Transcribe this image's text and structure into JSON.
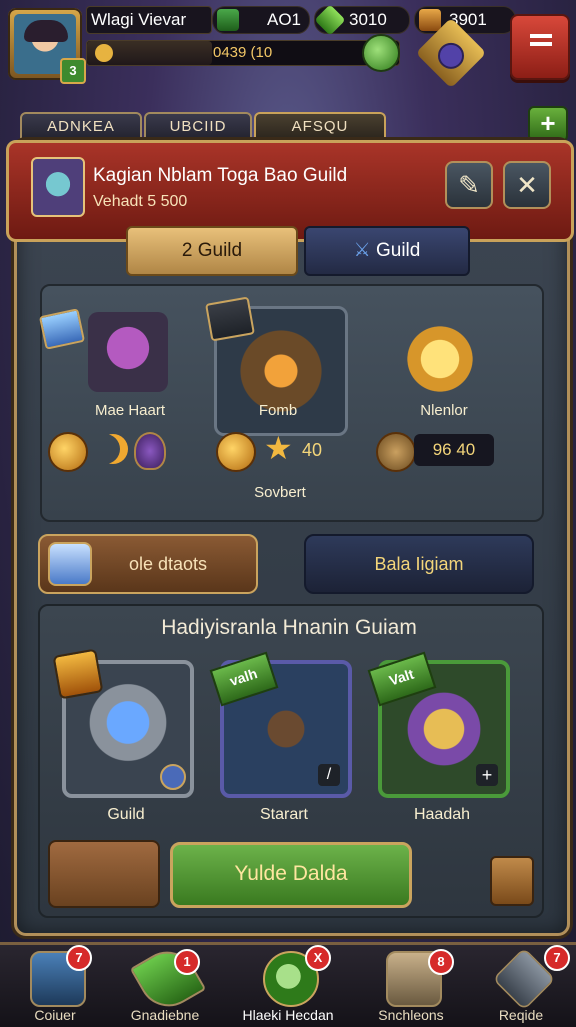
{
  "player": {
    "name": "Wlagi Vievar",
    "level": "3",
    "xp_text": "0439 (10",
    "xp_progress": 0.4
  },
  "resources": [
    {
      "icon": "gem-icon",
      "value": "AO1"
    },
    {
      "icon": "emerald-icon",
      "value": "3010"
    },
    {
      "icon": "gold-cube-icon",
      "value": "3901"
    }
  ],
  "colors": {
    "accent_gold": "#c9a25a",
    "banner_red": "#a93428",
    "nav_green": "#5aa63c"
  },
  "tabs": [
    "ADNKEA",
    "UBCIID",
    "AFSQU"
  ],
  "header": {
    "title": "Kagian Nblam Toga Bao Guild",
    "subtitle": "Vehadt 5 500",
    "edit_icon": "quill-icon",
    "close_icon": "close-icon"
  },
  "segments": {
    "left": "2 Guild",
    "right": "Guild"
  },
  "shop": {
    "items": [
      {
        "name": "Mae Haart"
      },
      {
        "name": "Fomb",
        "price": "40"
      },
      {
        "name": "Nlenlor",
        "price": "96 40"
      }
    ],
    "footer_label": "Sovbert"
  },
  "actions": {
    "left": "ole dtaots",
    "right": "Bala Iigiam"
  },
  "section": {
    "title": "Hadiyisranla Hnanin Guiam",
    "cards": [
      {
        "label": "Guild"
      },
      {
        "label": "Starart",
        "ribbon": "valh"
      },
      {
        "label": "Haadah",
        "ribbon": "Valt"
      }
    ],
    "confirm_button": "Yulde Dalda"
  },
  "nav": [
    {
      "label": "Coiuer",
      "badge": "7"
    },
    {
      "label": "Gnadiebne",
      "badge": "1"
    },
    {
      "label": "Hlaeki Hecdan",
      "badge": "X"
    },
    {
      "label": "Snchleons",
      "badge": "8"
    },
    {
      "label": "Reqide",
      "badge": "7"
    }
  ]
}
